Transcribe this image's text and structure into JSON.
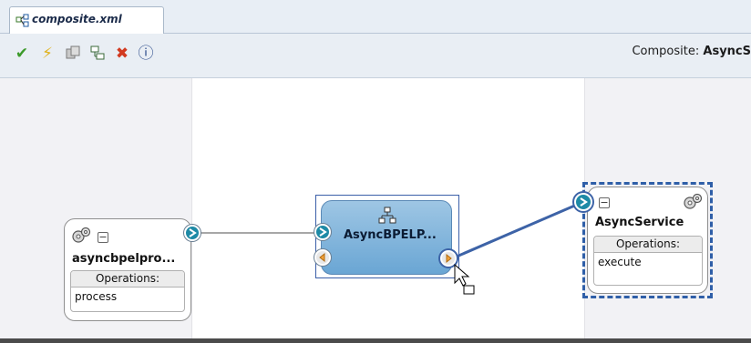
{
  "editor": {
    "tab_label": "composite.xml",
    "tab_icon": "composite-icon",
    "composite_prefix": "Composite: ",
    "composite_name": "AsyncS"
  },
  "toolbar": {
    "buttons": [
      {
        "name": "validate-icon",
        "glyph": "✔",
        "color": "#3c9a2a"
      },
      {
        "name": "lightning-icon",
        "glyph": "⚡",
        "color": "#e0b21d"
      },
      {
        "name": "copy-icon",
        "glyph": "▚",
        "color": "#8a8a8a"
      },
      {
        "name": "layout-icon",
        "glyph": "⧉",
        "color": "#4a6a3a"
      },
      {
        "name": "delete-icon",
        "glyph": "✖",
        "color": "#d23a20"
      },
      {
        "name": "info-icon",
        "glyph": "ⓘ",
        "color": "#2a4a8a"
      }
    ]
  },
  "components": {
    "client_service": {
      "title": "asyncbpelpro...",
      "operations_header": "Operations:",
      "operations": [
        "process"
      ]
    },
    "bpel_process": {
      "title": "AsyncBPELP..."
    },
    "reference_service": {
      "title": "AsyncService",
      "operations_header": "Operations:",
      "operations": [
        "execute"
      ]
    }
  },
  "colors": {
    "port_service": "#1e8aa6",
    "port_reference": "#f0a13a",
    "wire": "#3d63a7",
    "selection": "#2f5fa8"
  }
}
